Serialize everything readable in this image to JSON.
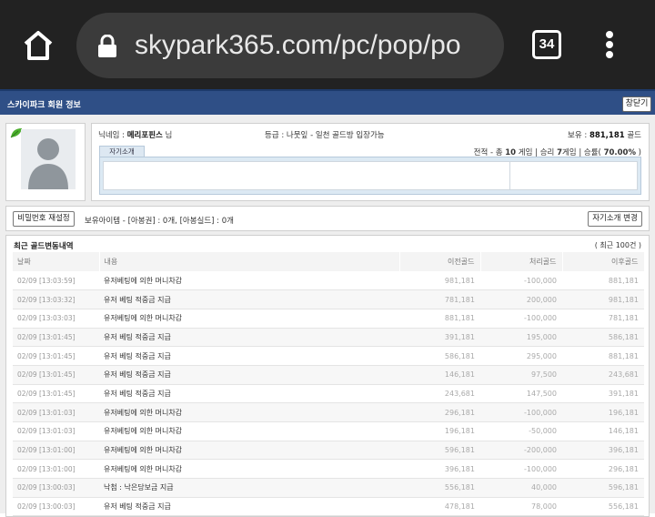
{
  "browser": {
    "url": "skypark365.com/pc/pop/po",
    "tab_count": "34"
  },
  "window": {
    "title": "스카이파크 회원 정보",
    "close_label": "창닫기"
  },
  "member": {
    "nickname_label": "닉네임 : ",
    "nickname": "메리포핀스",
    "nickname_suffix": " 님",
    "grade_text": "등급 : 나뭇잎 - 일천 골드방 입장가능",
    "holding_label": "보유 : ",
    "holding_value": "881,181",
    "holding_unit": " 골드",
    "intro_tab": "자기소개",
    "record_prefix": "전적 - 총 ",
    "total_games": "10",
    "record_mid1": " 게임 | 승리 ",
    "wins": "7",
    "record_mid2": "게임 | 승률( ",
    "win_rate": "70.00%",
    "record_suffix": " )"
  },
  "toolbar": {
    "reset_pw_label": "비밀번호 재설정",
    "items_text": "보유아이템 - [아봉권] : 0개, [아봉실드] : 0개",
    "edit_intro_label": "자기소개 변경"
  },
  "history": {
    "title": "최근 골드변동내역",
    "count_text": "( 최근 100건 )",
    "columns": [
      "날짜",
      "내용",
      "이전골드",
      "처리골드",
      "이후골드"
    ],
    "rows": [
      [
        "02/09 [13:03:59]",
        "유저베팅에 의한 머니차감",
        "981,181",
        "-100,000",
        "881,181"
      ],
      [
        "02/09 [13:03:32]",
        "유저 베팅 적중금 지급",
        "781,181",
        "200,000",
        "981,181"
      ],
      [
        "02/09 [13:03:03]",
        "유저베팅에 의한 머니차감",
        "881,181",
        "-100,000",
        "781,181"
      ],
      [
        "02/09 [13:01:45]",
        "유저 베팅 적중금 지급",
        "391,181",
        "195,000",
        "586,181"
      ],
      [
        "02/09 [13:01:45]",
        "유저 베팅 적중금 지급",
        "586,181",
        "295,000",
        "881,181"
      ],
      [
        "02/09 [13:01:45]",
        "유저 베팅 적중금 지급",
        "146,181",
        "97,500",
        "243,681"
      ],
      [
        "02/09 [13:01:45]",
        "유저 베팅 적중금 지급",
        "243,681",
        "147,500",
        "391,181"
      ],
      [
        "02/09 [13:01:03]",
        "유저베팅에 의한 머니차감",
        "296,181",
        "-100,000",
        "196,181"
      ],
      [
        "02/09 [13:01:03]",
        "유저베팅에 의한 머니차감",
        "196,181",
        "-50,000",
        "146,181"
      ],
      [
        "02/09 [13:01:00]",
        "유저베팅에 의한 머니차감",
        "596,181",
        "-200,000",
        "396,181"
      ],
      [
        "02/09 [13:01:00]",
        "유저베팅에 의한 머니차감",
        "396,181",
        "-100,000",
        "296,181"
      ],
      [
        "02/09 [13:00:03]",
        "낙첨 : 낙은당보금 지급",
        "556,181",
        "40,000",
        "596,181"
      ],
      [
        "02/09 [13:00:03]",
        "유저 베팅 적중금 지급",
        "478,181",
        "78,000",
        "556,181"
      ]
    ]
  }
}
